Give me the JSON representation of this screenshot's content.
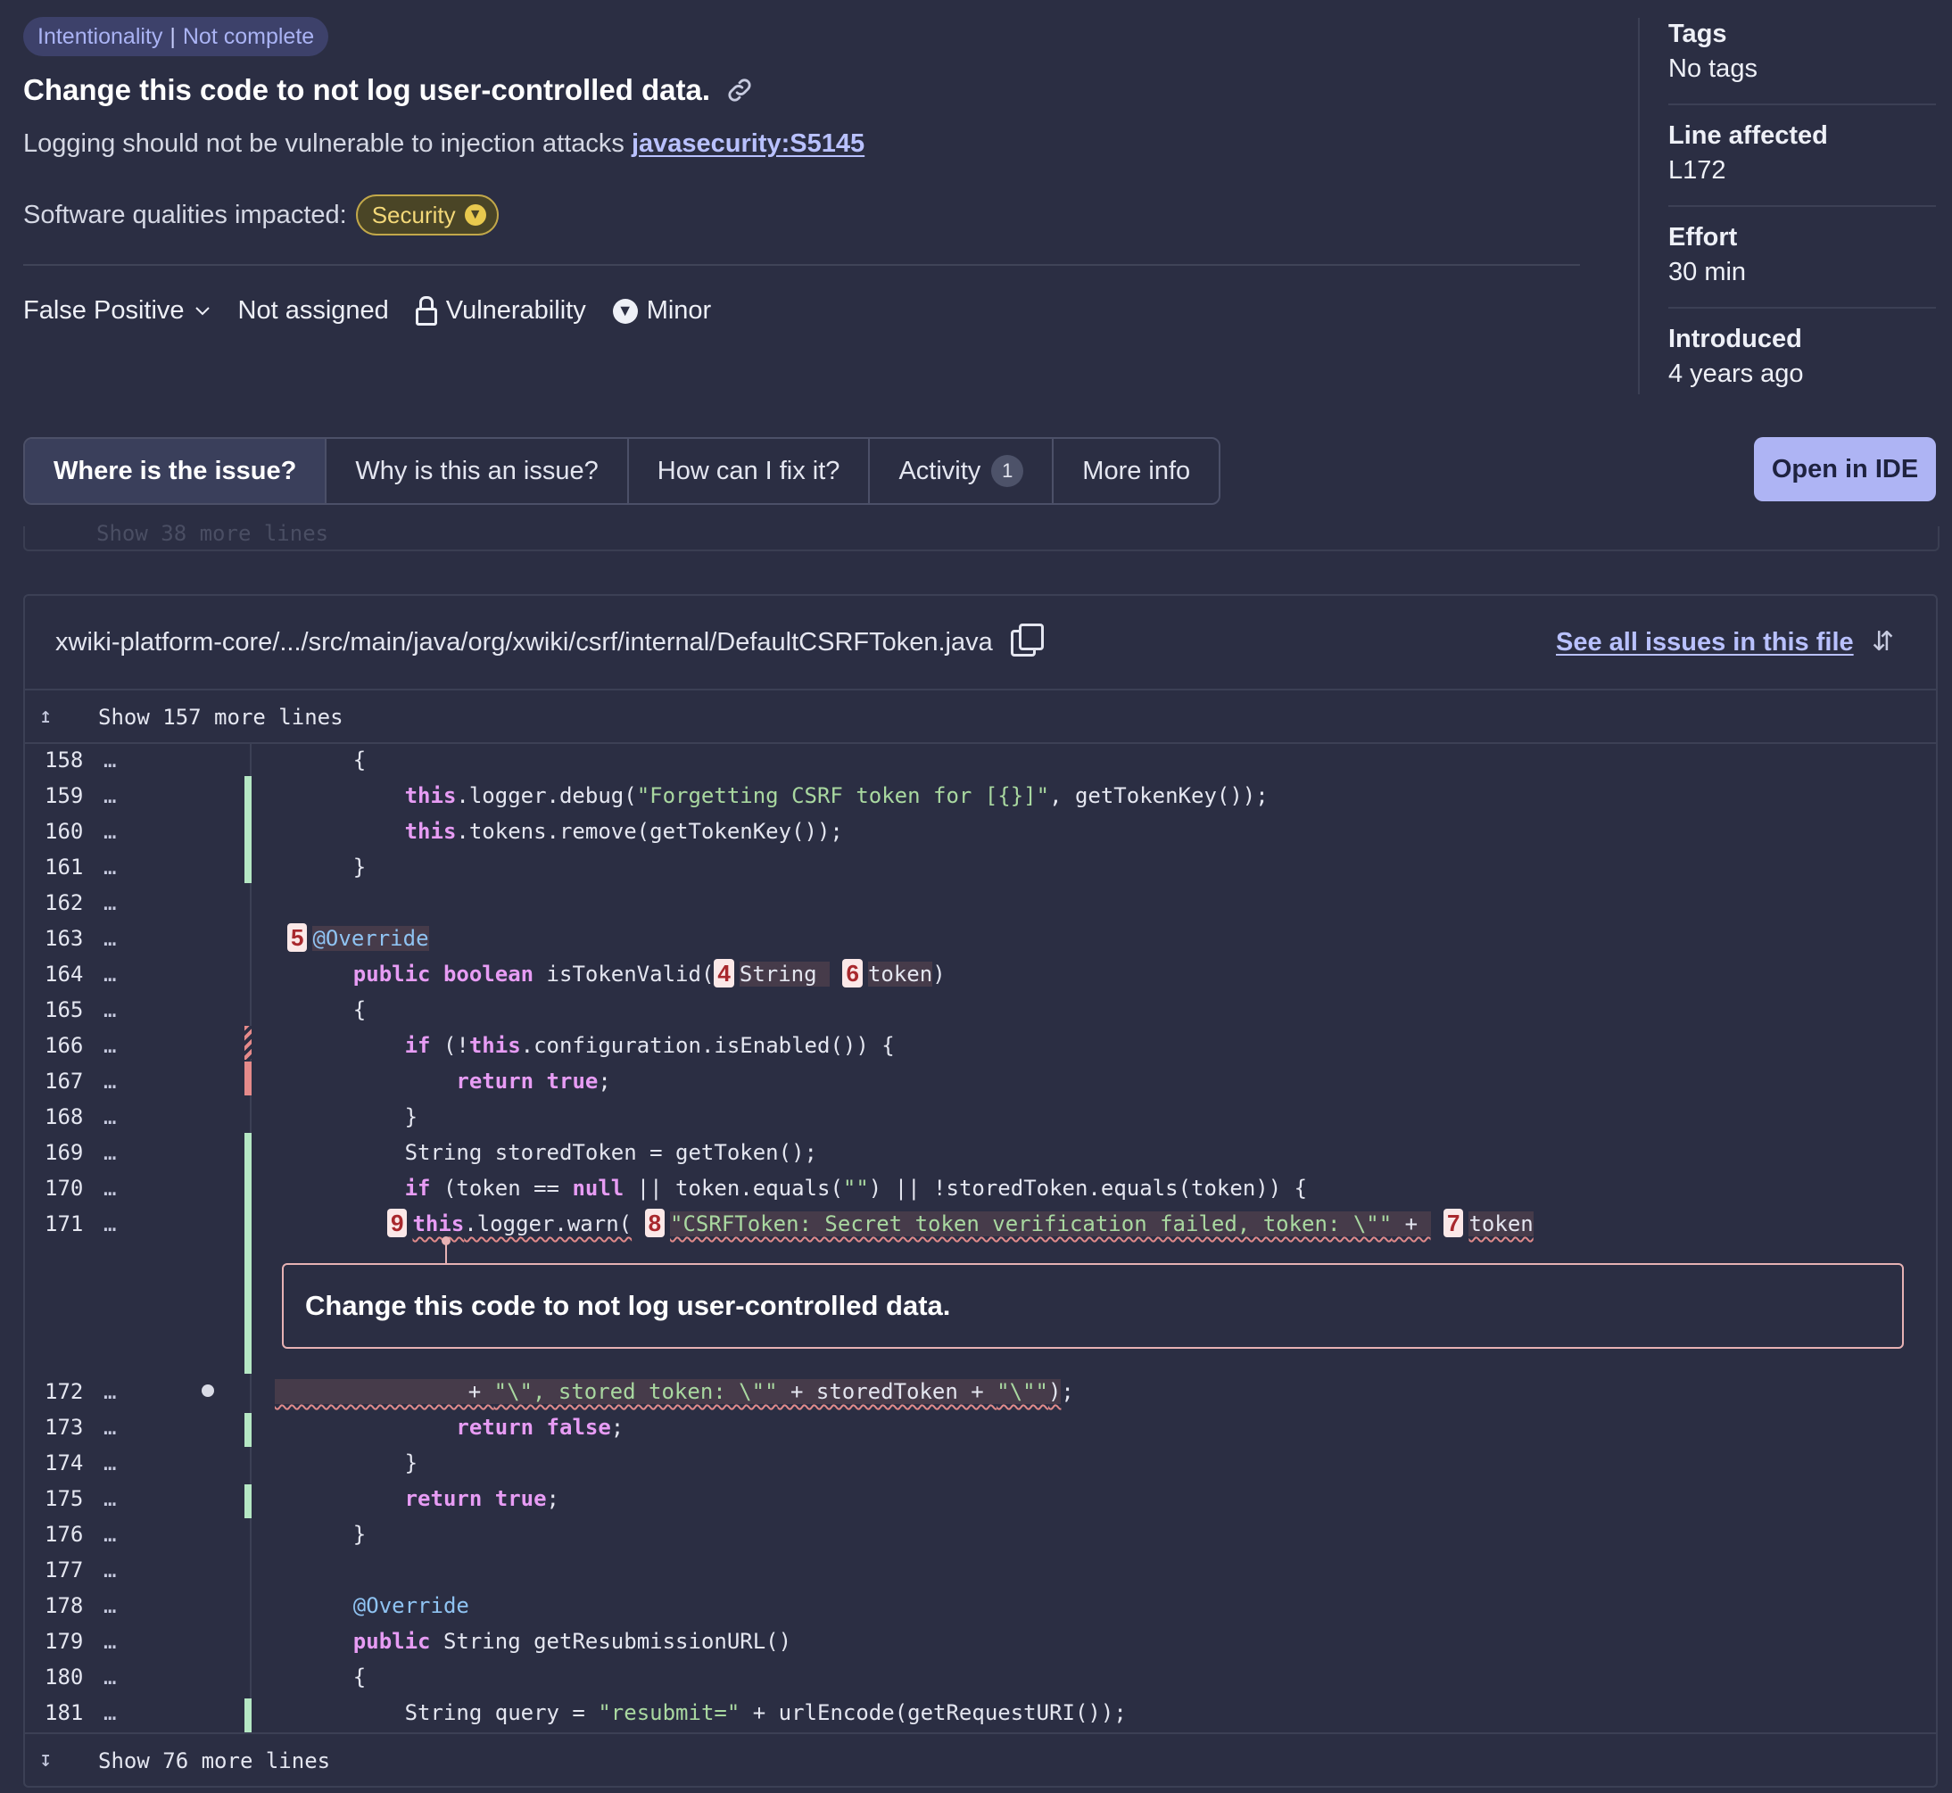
{
  "header": {
    "attribute": "Intentionality",
    "status": "Not complete",
    "title": "Change this code to not log user-controlled data.",
    "description": "Logging should not be vulnerable to injection attacks",
    "rule_key": "javasecurity:S5145",
    "qualities_label": "Software qualities impacted:",
    "quality_badge": "Security",
    "resolution": "False Positive",
    "assignee": "Not assigned",
    "type": "Vulnerability",
    "severity": "Minor"
  },
  "sidebar": {
    "tags_label": "Tags",
    "tags_value": "No tags",
    "line_label": "Line affected",
    "line_value": "L172",
    "effort_label": "Effort",
    "effort_value": "30 min",
    "introduced_label": "Introduced",
    "introduced_value": "4 years ago"
  },
  "tabs": [
    {
      "label": "Where is the issue?"
    },
    {
      "label": "Why is this an issue?"
    },
    {
      "label": "How can I fix it?"
    },
    {
      "label": "Activity",
      "count": "1"
    },
    {
      "label": "More info"
    }
  ],
  "open_ide_label": "Open in IDE",
  "ghost_text": "Show 38 more lines",
  "code_viewer": {
    "file_path": "xwiki-platform-core/.../src/main/java/org/xwiki/csrf/internal/DefaultCSRFToken.java",
    "see_all_label": "See all issues in this file",
    "show_more_top": "Show 157 more lines",
    "show_more_bottom": "Show 76 more lines",
    "dots": "…",
    "issue_message": "Change this code to not log user-controlled data.",
    "lines": {
      "l158": "158",
      "l159": "159",
      "l160": "160",
      "l161": "161",
      "l162": "162",
      "l163": "163",
      "l164": "164",
      "l165": "165",
      "l166": "166",
      "l167": "167",
      "l168": "168",
      "l169": "169",
      "l170": "170",
      "l171": "171",
      "l172": "172",
      "l173": "173",
      "l174": "174",
      "l175": "175",
      "l176": "176",
      "l177": "177",
      "l178": "178",
      "l179": "179",
      "l180": "180",
      "l181": "181"
    },
    "markers": {
      "m4": "4",
      "m5": "5",
      "m6": "6",
      "m7": "7",
      "m8": "8",
      "m9": "9"
    }
  },
  "colors": {
    "background": "#2b2e43",
    "accent": "#aeb4f4",
    "covered": "#b5e7c4",
    "uncovered": "#e58a8a",
    "issue": "#e7b2b4"
  }
}
